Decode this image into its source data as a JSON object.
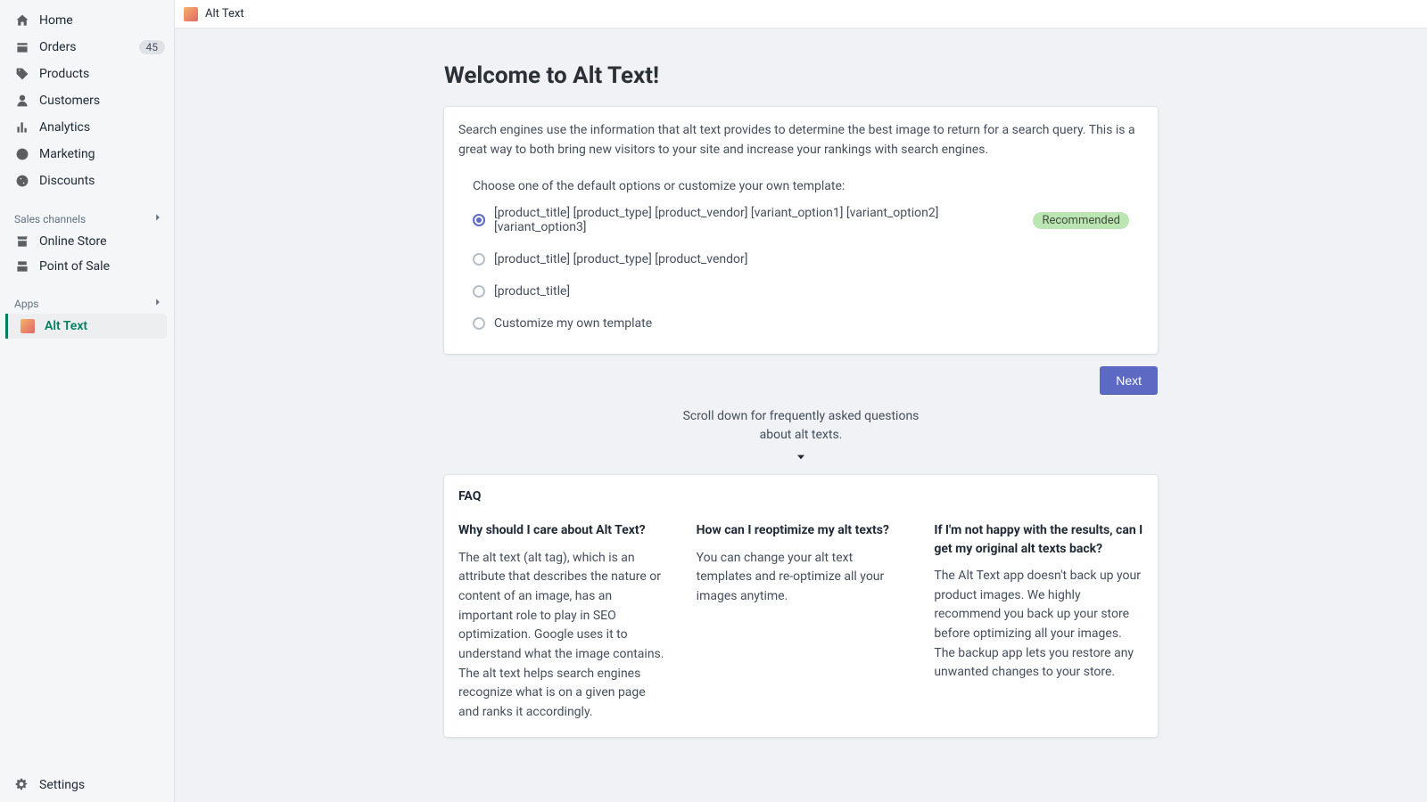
{
  "sidebar": {
    "nav": [
      {
        "id": "home",
        "label": "Home"
      },
      {
        "id": "orders",
        "label": "Orders",
        "badge": "45"
      },
      {
        "id": "products",
        "label": "Products"
      },
      {
        "id": "customers",
        "label": "Customers"
      },
      {
        "id": "analytics",
        "label": "Analytics"
      },
      {
        "id": "marketing",
        "label": "Marketing"
      },
      {
        "id": "discounts",
        "label": "Discounts"
      }
    ],
    "section_channels": "Sales channels",
    "channels": [
      {
        "id": "online-store",
        "label": "Online Store"
      },
      {
        "id": "pos",
        "label": "Point of Sale"
      }
    ],
    "section_apps": "Apps",
    "apps": [
      {
        "id": "alt-text",
        "label": "Alt Text",
        "active": true
      }
    ],
    "settings_label": "Settings"
  },
  "topbar": {
    "title": "Alt Text"
  },
  "page": {
    "title": "Welcome to Alt Text!",
    "desc": "Search engines use the information that alt text provides to determine the best image to return for a search query. This is a great way to both bring new visitors to your site and increase your rankings with search engines.",
    "choose_label": "Choose one of the default options or customize your own template:",
    "options": [
      {
        "label": "[product_title] [product_type] [product_vendor] [variant_option1] [variant_option2] [variant_option3]",
        "recommended": true,
        "checked": true
      },
      {
        "label": "[product_title] [product_type] [product_vendor]"
      },
      {
        "label": "[product_title]"
      },
      {
        "label": "Customize my own template"
      }
    ],
    "recommended_text": "Recommended",
    "next_button": "Next",
    "scroll_hint": "Scroll down for frequently asked questions about alt texts."
  },
  "faq": {
    "heading": "FAQ",
    "items": [
      {
        "q": "Why should I care about Alt Text?",
        "a": "The alt text (alt tag), which is an attribute that describes the nature or content of an image, has an important role to play in SEO optimization. Google uses it to understand what the image contains. The alt text helps search engines recognize what is on a given page and ranks it accordingly."
      },
      {
        "q": "How can I reoptimize my alt texts?",
        "a": "You can change your alt text templates and re-optimize all your images anytime."
      },
      {
        "q": "If I'm not happy with the results, can I get my original alt texts back?",
        "a": "The Alt Text app doesn't back up your product images. We highly recommend you back up your store before optimizing all your images. The backup app lets you restore any unwanted changes to your store."
      }
    ]
  }
}
